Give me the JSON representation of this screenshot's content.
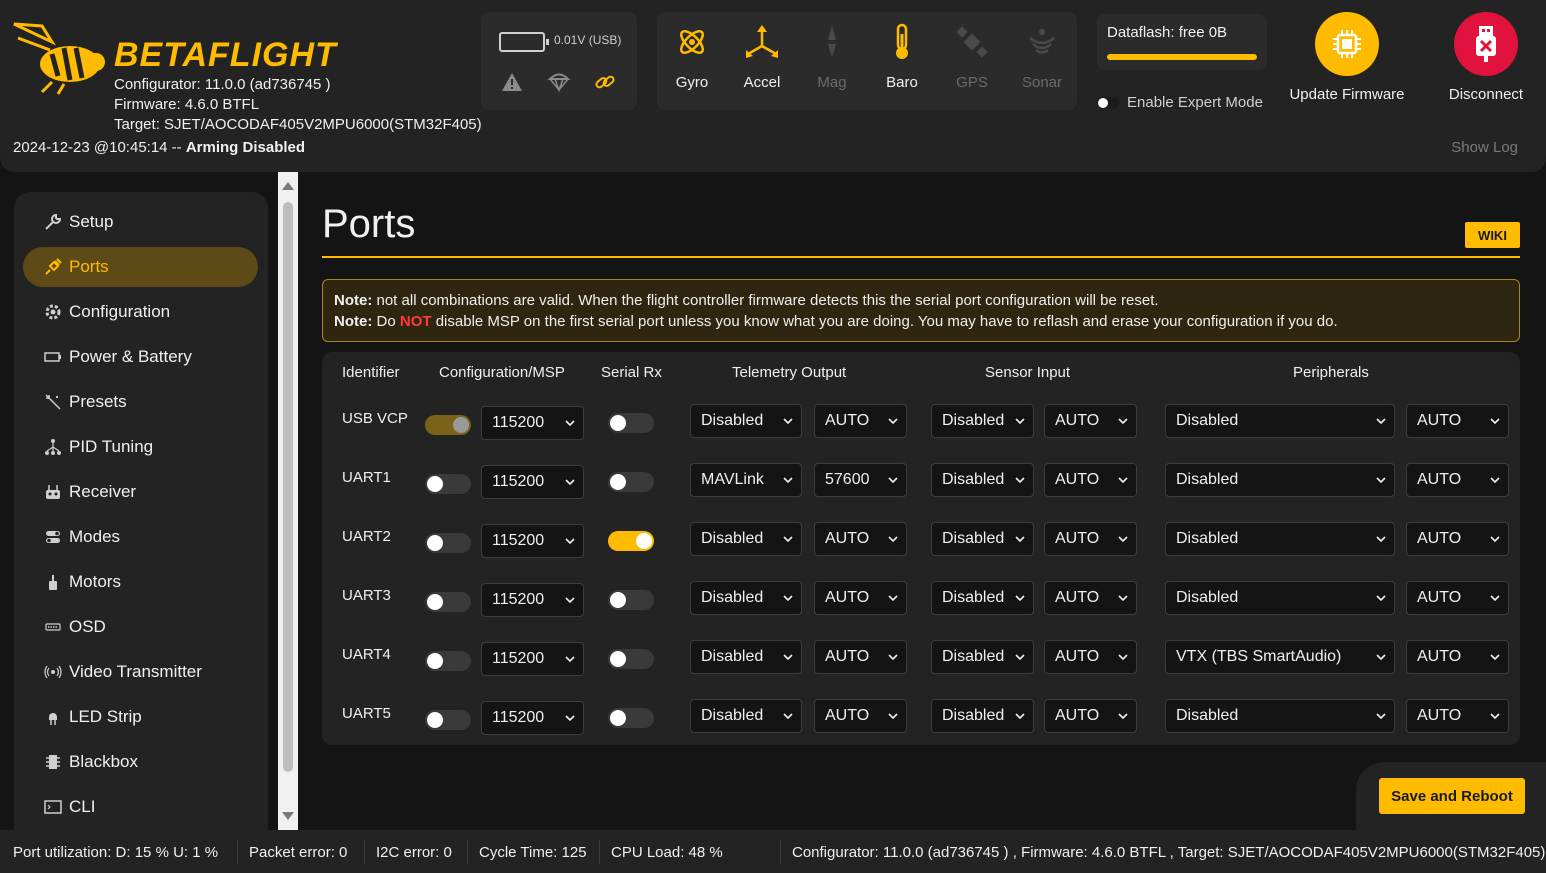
{
  "header": {
    "brand": "BETAFLIGHT",
    "configurator": "Configurator: 11.0.0 (ad736745 )",
    "firmware": "Firmware: 4.6.0 BTFL",
    "target": "Target: SJET/AOCODAF405V2MPU6000(STM32F405)",
    "timestamp": "2024-12-23 @10:45:14 --",
    "arming": "Arming Disabled",
    "battery_text": "0.01V (USB)",
    "sensors": [
      {
        "label": "Gyro",
        "active": true
      },
      {
        "label": "Accel",
        "active": true
      },
      {
        "label": "Mag",
        "active": false
      },
      {
        "label": "Baro",
        "active": true
      },
      {
        "label": "GPS",
        "active": false
      },
      {
        "label": "Sonar",
        "active": false
      }
    ],
    "dataflash": "Dataflash: free 0B",
    "expert_mode": "Enable Expert Mode",
    "update_firmware": "Update Firmware",
    "disconnect": "Disconnect",
    "show_log": "Show Log",
    "accent": "#ffbb00",
    "disconnect_color": "#e2123f"
  },
  "sidebar": {
    "items": [
      {
        "label": "Setup",
        "icon": "wrench-icon"
      },
      {
        "label": "Ports",
        "icon": "plug-icon",
        "active": true
      },
      {
        "label": "Configuration",
        "icon": "gear-icon"
      },
      {
        "label": "Power & Battery",
        "icon": "battery-icon"
      },
      {
        "label": "Presets",
        "icon": "sparkle-icon"
      },
      {
        "label": "PID Tuning",
        "icon": "pid-icon"
      },
      {
        "label": "Receiver",
        "icon": "receiver-icon"
      },
      {
        "label": "Modes",
        "icon": "modes-icon"
      },
      {
        "label": "Motors",
        "icon": "motor-icon"
      },
      {
        "label": "OSD",
        "icon": "osd-icon"
      },
      {
        "label": "Video Transmitter",
        "icon": "vtx-icon"
      },
      {
        "label": "LED Strip",
        "icon": "led-icon"
      },
      {
        "label": "Blackbox",
        "icon": "blackbox-icon"
      },
      {
        "label": "CLI",
        "icon": "cli-icon"
      }
    ]
  },
  "page": {
    "title": "Ports",
    "wiki": "WIKI",
    "note1_label": "Note:",
    "note1_text": "not all combinations are valid. When the flight controller firmware detects this the serial port configuration will be reset.",
    "note2_label": "Note:",
    "note2_pre": "Do",
    "note2_red": "NOT",
    "note2_post": "disable MSP on the first serial port unless you know what you are doing. You may have to reflash and erase your configuration if you do."
  },
  "table": {
    "headers": [
      "Identifier",
      "Configuration/MSP",
      "Serial Rx",
      "Telemetry Output",
      "Sensor Input",
      "Peripherals"
    ],
    "rows": [
      {
        "id": "USB VCP",
        "msp": "locked",
        "msp_baud": "115200",
        "rx": false,
        "tel": "Disabled",
        "tel_baud": "AUTO",
        "sen": "Disabled",
        "sen_baud": "AUTO",
        "per": "Disabled",
        "per_baud": "AUTO"
      },
      {
        "id": "UART1",
        "msp": false,
        "msp_baud": "115200",
        "rx": false,
        "tel": "MAVLink",
        "tel_baud": "57600",
        "sen": "Disabled",
        "sen_baud": "AUTO",
        "per": "Disabled",
        "per_baud": "AUTO"
      },
      {
        "id": "UART2",
        "msp": false,
        "msp_baud": "115200",
        "rx": true,
        "tel": "Disabled",
        "tel_baud": "AUTO",
        "sen": "Disabled",
        "sen_baud": "AUTO",
        "per": "Disabled",
        "per_baud": "AUTO"
      },
      {
        "id": "UART3",
        "msp": false,
        "msp_baud": "115200",
        "rx": false,
        "tel": "Disabled",
        "tel_baud": "AUTO",
        "sen": "Disabled",
        "sen_baud": "AUTO",
        "per": "Disabled",
        "per_baud": "AUTO"
      },
      {
        "id": "UART4",
        "msp": false,
        "msp_baud": "115200",
        "rx": false,
        "tel": "Disabled",
        "tel_baud": "AUTO",
        "sen": "Disabled",
        "sen_baud": "AUTO",
        "per": "VTX (TBS SmartAudio)",
        "per_baud": "AUTO"
      },
      {
        "id": "UART5",
        "msp": false,
        "msp_baud": "115200",
        "rx": false,
        "tel": "Disabled",
        "tel_baud": "AUTO",
        "sen": "Disabled",
        "sen_baud": "AUTO",
        "per": "Disabled",
        "per_baud": "AUTO"
      }
    ]
  },
  "save_button": "Save and Reboot",
  "footer": {
    "port_util": "Port utilization: D: 15 % U: 1 %",
    "packet_error": "Packet error: 0",
    "i2c_error": "I2C error: 0",
    "cycle_time": "Cycle Time: 125",
    "cpu_load": "CPU Load: 48 %",
    "version": "Configurator: 11.0.0 (ad736745 ) , Firmware: 4.6.0 BTFL , Target: SJET/AOCODAF405V2MPU6000(STM32F405)"
  }
}
